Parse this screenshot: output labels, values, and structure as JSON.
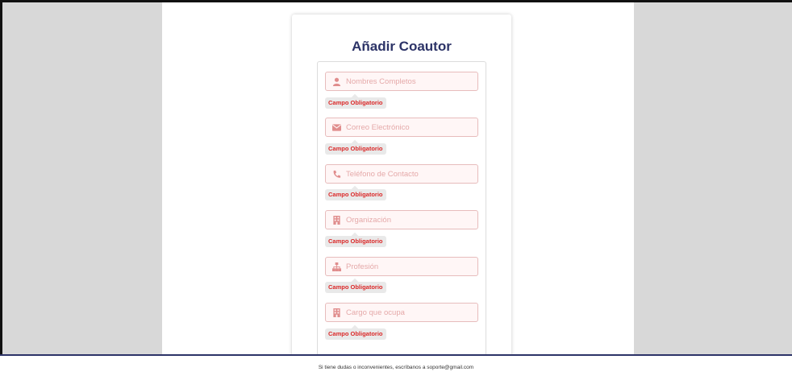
{
  "form": {
    "title": "Añadir Coautor",
    "fields": [
      {
        "icon": "user-icon",
        "placeholder": "Nombres Completos",
        "error": "Campo Obligatorio"
      },
      {
        "icon": "envelope-icon",
        "placeholder": "Correo Electrónico",
        "error": "Campo Obligatorio"
      },
      {
        "icon": "phone-icon",
        "placeholder": "Teléfono de Contacto",
        "error": "Campo Obligatorio"
      },
      {
        "icon": "building-icon",
        "placeholder": "Organización",
        "error": "Campo Obligatorio"
      },
      {
        "icon": "sitemap-icon",
        "placeholder": "Profesión",
        "error": "Campo Obligatorio"
      },
      {
        "icon": "building-icon",
        "placeholder": "Cargo que ocupa",
        "error": "Campo Obligatorio"
      }
    ]
  },
  "footer": {
    "text": "Si tiene dudas o inconvenientes, escríbanos a soporte@gmail.com"
  },
  "colors": {
    "title": "#2c3367",
    "error_text": "#db2828",
    "field_bg": "#fff6f6",
    "field_border": "#e7bcbc",
    "side_panel": "#d8d8d8"
  }
}
